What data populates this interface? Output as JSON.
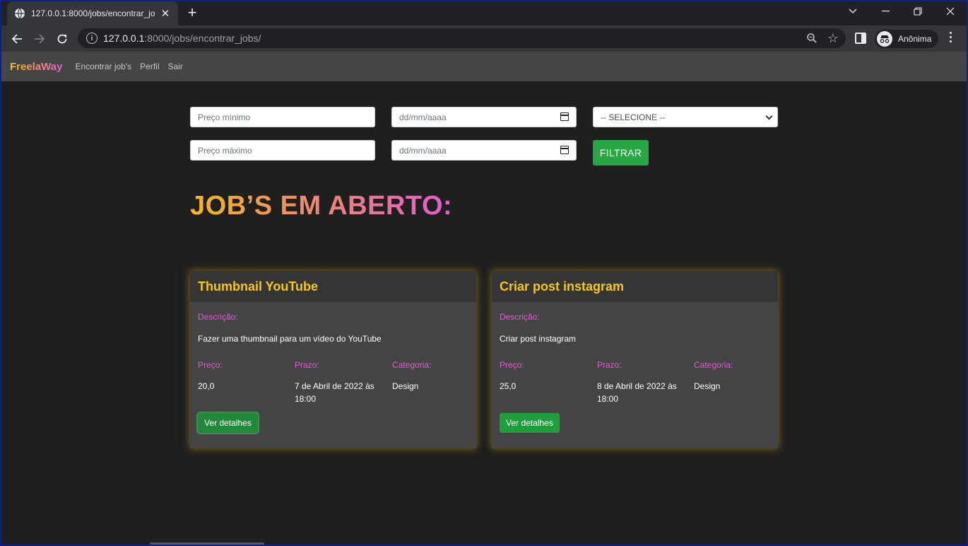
{
  "browser": {
    "tab_title": "127.0.0.1:8000/jobs/encontrar_jobs/",
    "url_host": "127.0.0.1",
    "url_rest": ":8000/jobs/encontrar_jobs/",
    "profile_label": "Anônima",
    "icons": [
      "globe-icon",
      "close-icon",
      "plus-icon",
      "chevron-down-icon",
      "minimize-icon",
      "restore-icon",
      "back-icon",
      "forward-icon",
      "reload-icon",
      "info-icon",
      "zoom-icon",
      "star-icon",
      "side-panel-icon",
      "incognito-icon",
      "menu-icon"
    ]
  },
  "nav": {
    "brand": "FreelaWay",
    "links": [
      "Encontrar job's",
      "Perfil",
      "Sair"
    ]
  },
  "filters": {
    "min_price_placeholder": "Preço mínimo",
    "max_price_placeholder": "Preço máximo",
    "date_start": "dd/mm/aaaa",
    "date_end": "dd/mm/aaaa",
    "category_selected": "-- SELECIONE --",
    "submit_label": "FILTRAR"
  },
  "heading": "JOB’S EM ABERTO:",
  "labels": {
    "description": "Descrição:",
    "price": "Preço:",
    "deadline": "Prazo:",
    "category": "Categoria:",
    "details_button": "Ver detalhes"
  },
  "jobs": [
    {
      "title": "Thumbnail YouTube",
      "description": "Fazer uma thumbnail para um vídeo do YouTube",
      "price": "20,0",
      "deadline": "7 de Abril de 2022 às 18:00",
      "category": "Design"
    },
    {
      "title": "Criar post instagram",
      "description": "Criar post instagram",
      "price": "25,0",
      "deadline": "8 de Abril de 2022 às 18:00",
      "category": "Design"
    }
  ],
  "colors": {
    "accent_yellow": "#f7c617",
    "accent_pink": "#e15ad0",
    "button_green": "#28a745",
    "card_bg": "#444444",
    "page_bg": "#1f1f1f"
  }
}
